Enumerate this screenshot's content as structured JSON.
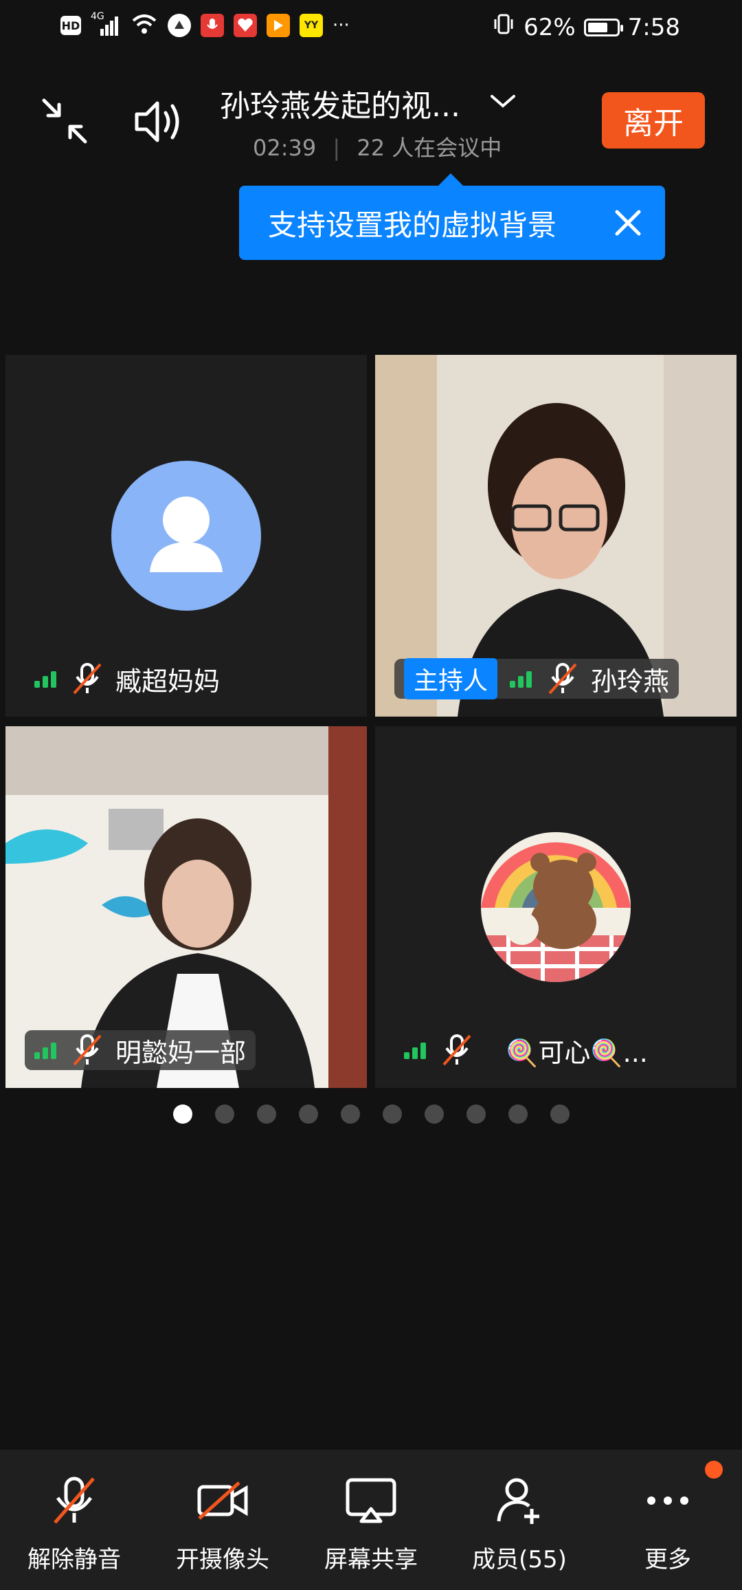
{
  "status_bar": {
    "battery": "62%",
    "time": "7:58",
    "network": "4G",
    "hd": "HD",
    "more": "···"
  },
  "header": {
    "title": "孙玲燕发起的视...",
    "elapsed": "02:39",
    "participants_text": "22 人在会议中",
    "leave_label": "离开"
  },
  "tooltip": {
    "text": "支持设置我的虚拟背景"
  },
  "tiles": [
    {
      "name": "臧超妈妈",
      "avatar": "default-avatar",
      "muted": true
    },
    {
      "name": "孙玲燕",
      "host_badge": "主持人",
      "muted": true
    },
    {
      "name": "明懿妈一部",
      "muted": true
    },
    {
      "name": "🍭可心🍭...",
      "avatar": "bear-avatar",
      "muted": true
    }
  ],
  "pagination": {
    "pages": 10,
    "current": 1
  },
  "bottom_bar": {
    "unmute": "解除静音",
    "camera": "开摄像头",
    "share": "屏幕共享",
    "members": "成员(55)",
    "more": "更多"
  },
  "colors": {
    "accent_blue": "#0a84ff",
    "leave_orange": "#f2561d",
    "signal_green": "#22c55e"
  }
}
